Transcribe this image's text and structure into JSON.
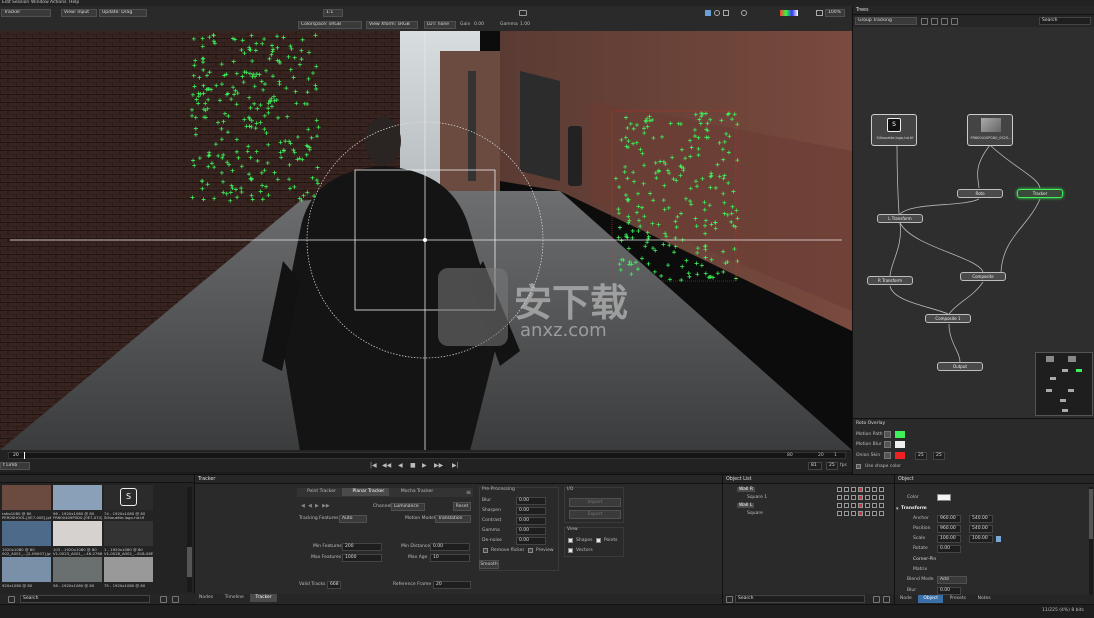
{
  "menu": [
    "Edit",
    "Session",
    "Window",
    "Actions",
    "Help"
  ],
  "viewer_toolbar": {
    "mode": "Tracker",
    "view_input": "View: Input",
    "update": "Update: Drag",
    "zoom_ratio": "1:1",
    "colorspace": "Colorspace: sRGB",
    "view_xform": "View Xform: sRGB",
    "lut": "LUT: none",
    "gain_label": "Gain",
    "gain_value": "0.00",
    "gamma_label": "Gamma",
    "gamma_value": "1.00",
    "zoom_percent": "100%"
  },
  "watermark": {
    "text": "安下载",
    "sub": "anxz.com"
  },
  "timeline": {
    "start": "20",
    "current": "80",
    "end": "20",
    "frame": "1",
    "right_a": "81",
    "right_b": "25",
    "fps": "fps",
    "left_dropdown": "t Limb"
  },
  "trees": {
    "title": "Trees",
    "group": "Group Tracking",
    "search": "Search",
    "nodes": {
      "logo_label": "Silhouette-logo-hd.tif",
      "clip_label": "FR600410P0D0_0S25...",
      "roto": "Roto",
      "tracker": "Tracker",
      "ltransform": "L Transform",
      "rtransform": "R Transform",
      "composite": "Composite",
      "composite1": "Composite 1",
      "output": "Output"
    }
  },
  "roto_overlay": {
    "title": "Roto Overlay",
    "motion_path": "Motion Path",
    "motion_blur": "Motion Blur",
    "onion_skin": "Onion Skin",
    "onion_a": "25",
    "onion_b": "25",
    "use_shape_color": "Use shape color"
  },
  "media": {
    "items": [
      {
        "label": "ratio1080 @ 80",
        "sub": "PER0SHOOL-[0E7-00E].jpf"
      },
      {
        "label": "96 - 1920x1080 @ 80",
        "sub": "FR600409P0D0-[0E7-074].jpf"
      },
      {
        "label": "74 - 1920x1080 @ 80",
        "sub": "Silhouette-logo-hd.tif"
      },
      {
        "label": "1920x1080 @ 80",
        "sub": "002_A001_...[2-H0007].jpf"
      },
      {
        "label": "103 - 1920x1080 @ 80",
        "sub": "V1-0023_A001_...46-2766].jpf"
      },
      {
        "label": "1 - 1920x1080 @ 80",
        "sub": "V1-0026_A002_...618-06E2].jpf"
      },
      {
        "label": "920x1080 @ 80",
        "sub": ""
      },
      {
        "label": "56 - 1920x1080 @ 80",
        "sub": ""
      },
      {
        "label": "75 - 1920x1080 @ 80",
        "sub": ""
      }
    ],
    "search": "Search"
  },
  "tracker": {
    "title": "Tracker",
    "tabs": [
      "Point Tracker",
      "Planar Tracker",
      "Mocha Tracker"
    ],
    "channel_label": "Channel",
    "channel_value": "Luminance",
    "reset": "Reset",
    "tracking_features_label": "Tracking Features",
    "tracking_features_value": "Auto",
    "motion_model_label": "Motion Model",
    "motion_model_value": "Translation",
    "min_features_label": "Min Features",
    "min_features_value": "200",
    "max_features_label": "Max Features",
    "max_features_value": "1000",
    "min_distance_label": "Min Distance",
    "min_distance_value": "0.00",
    "max_age_label": "Max Age",
    "max_age_value": "10",
    "valid_tracks_label": "Valid Tracks",
    "valid_tracks_value": "668",
    "reference_frame_label": "Reference Frame",
    "reference_frame_value": "20",
    "preprocessing": {
      "title": "Pre-Processing",
      "rows": [
        {
          "label": "Blur",
          "value": "0.00"
        },
        {
          "label": "Sharpen",
          "value": "0.00"
        },
        {
          "label": "Contrast",
          "value": "0.00"
        },
        {
          "label": "Gamma",
          "value": "0.00"
        },
        {
          "label": "De-noise",
          "value": "0.00"
        }
      ],
      "remove_flicker": "Remove flicker",
      "preview": "Preview",
      "smooth": "Smooth"
    },
    "io": {
      "title": "I/O",
      "import": "Import",
      "export": "Export"
    },
    "view": {
      "title": "View",
      "shapes": "Shapes",
      "points": "Points",
      "vectors": "Vectors"
    }
  },
  "bottom_tabs": [
    "Nodes",
    "Timeline",
    "Tracker"
  ],
  "object_list": {
    "title": "Object List",
    "items": [
      {
        "label": "Wall R",
        "level": 0
      },
      {
        "label": "Square 1",
        "level": 1
      },
      {
        "label": "Wall L",
        "level": 0
      },
      {
        "label": "Square",
        "level": 1
      }
    ],
    "search": "Search"
  },
  "object": {
    "title": "Object",
    "color_label": "Color",
    "transform": "Transform",
    "anchor_label": "Anchor",
    "anchor_x": "960.00",
    "anchor_y": "540.00",
    "position_label": "Position",
    "position_x": "960.00",
    "position_y": "540.00",
    "scale_label": "Scale",
    "scale_x": "100.00",
    "scale_y": "100.00",
    "rotate_label": "Rotate",
    "rotate_value": "0.00",
    "corner_pin": "Corner-Pin",
    "matrix": "Matrix",
    "blend_mode_label": "Blend Mode",
    "blend_mode_value": "Add",
    "blur_label": "Blur",
    "blur_value": "0.00",
    "tabs": [
      "Node",
      "Object",
      "Presets",
      "Notes"
    ]
  },
  "status": {
    "text": "11/225 (4%)  8 bits"
  },
  "colors": {
    "tracker_green": "#3ef05a",
    "panel": "#2a2a2a",
    "accent_blue": "#3a6fa8"
  }
}
